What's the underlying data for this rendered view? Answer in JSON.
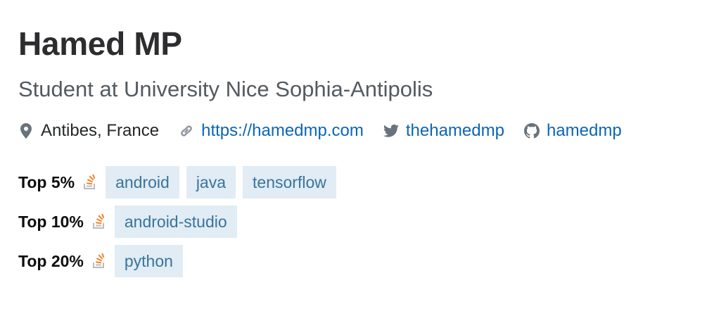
{
  "profile": {
    "name": "Hamed MP",
    "title": "Student at University Nice Sophia-Antipolis",
    "location": "Antibes, France",
    "website": "https://hamedmp.com",
    "twitter": "thehamedmp",
    "github": "hamedmp"
  },
  "tag_rows": [
    {
      "rank": "Top 5%",
      "tags": [
        "android",
        "java",
        "tensorflow"
      ]
    },
    {
      "rank": "Top 10%",
      "tags": [
        "android-studio"
      ]
    },
    {
      "rank": "Top 20%",
      "tags": [
        "python"
      ]
    }
  ],
  "colors": {
    "link": "#0c65b7",
    "tag_bg": "#e1ecf4",
    "tag_text": "#39739d",
    "so_orange": "#f48024",
    "so_gray": "#bcbbbb"
  },
  "icons": {
    "location": "location-pin-icon",
    "website": "link-icon",
    "twitter": "twitter-icon",
    "github": "github-icon",
    "rank": "stackoverflow-icon"
  }
}
